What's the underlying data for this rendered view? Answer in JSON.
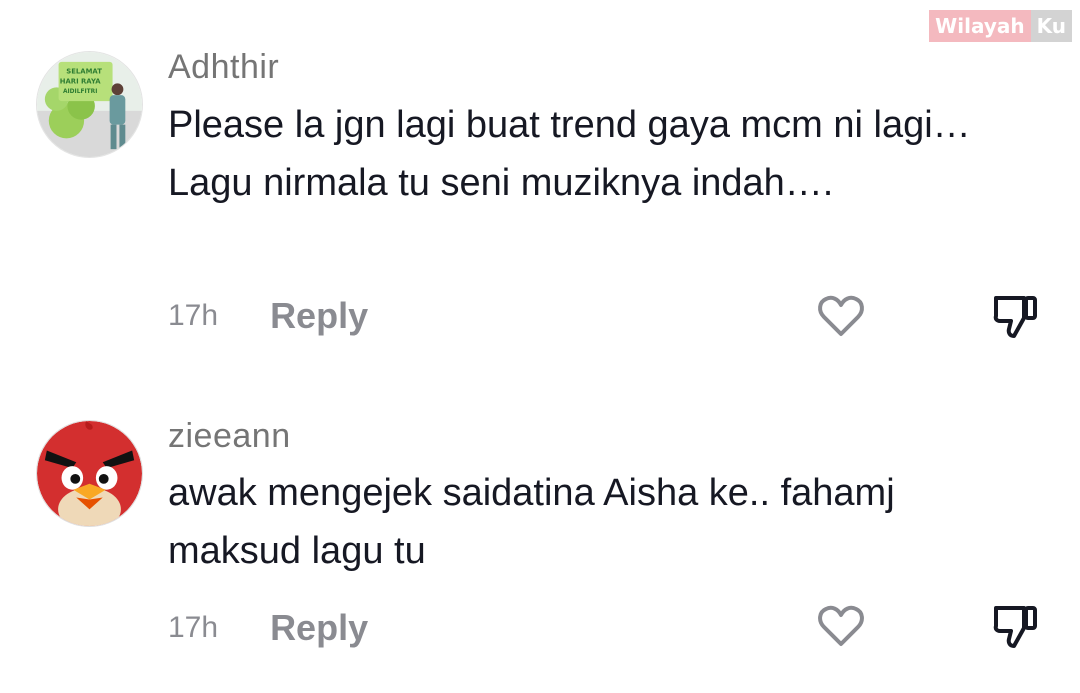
{
  "watermark": {
    "part1": "Wilayah",
    "part2": "Ku"
  },
  "comments": [
    {
      "username": "Adhthir",
      "text": "Please la jgn lagi buat trend gaya mcm ni lagi… Lagu nirmala tu seni muziknya indah….",
      "time": "17h",
      "reply_label": "Reply",
      "avatar": "photo-avatar",
      "avatar_banner": [
        "SELAMAT",
        "HARI RAYA",
        "AIDILFITRI"
      ]
    },
    {
      "username": "zieeann",
      "text": "awak mengejek saidatina Aisha ke.. fahamj maksud lagu tu",
      "time": "17h",
      "reply_label": "Reply",
      "avatar": "angry-bird-avatar"
    }
  ],
  "icons": {
    "like": "heart-icon",
    "dislike": "thumbs-down-icon"
  },
  "colors": {
    "username": "#757575",
    "meta": "#8a8b91",
    "text": "#161823",
    "watermark_pink": "#f4b9bf"
  }
}
